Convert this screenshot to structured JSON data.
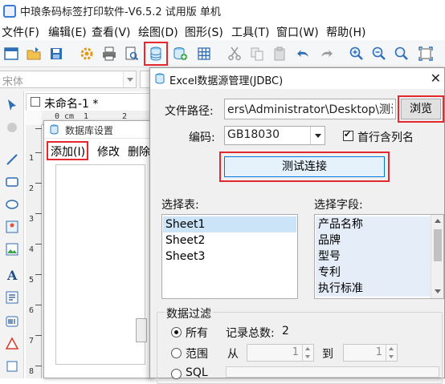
{
  "window": {
    "title": "中琅条码标签打印软件-V6.5.2 试用版 单机"
  },
  "menubar": {
    "items": [
      "文件(F)",
      "编辑(E)",
      "查看(V)",
      "绘图(D)",
      "图形(S)",
      "工具(T)",
      "窗口(W)",
      "帮助(H)"
    ]
  },
  "toolbar": {
    "icons": [
      "new-document-icon",
      "open-folder-icon",
      "save-icon",
      "settings-gear-icon",
      "print-icon",
      "print-preview-icon",
      "database-icon",
      "database-add-icon",
      "grid-icon",
      "cut-icon",
      "copy-icon",
      "paste-icon",
      "undo-icon",
      "redo-icon",
      "zoom-in-icon",
      "zoom-out-icon",
      "zoom-fit-icon",
      "zoom-page-icon"
    ],
    "highlighted": "database-icon"
  },
  "font_combo": {
    "value": "宋体"
  },
  "document": {
    "tab_label": "未命名-1 *",
    "ruler_top": [
      "0",
      "cm",
      "1",
      "2"
    ],
    "ruler_left": [
      "1",
      "2",
      "3",
      "4",
      "5",
      "6",
      "7",
      "8"
    ]
  },
  "db_settings": {
    "title": "数据库设置",
    "menu": {
      "add": "添加(I)",
      "modify": "修改",
      "delete": "删除"
    }
  },
  "excel_dialog": {
    "title": "Excel数据源管理(JDBC)",
    "close": "✕",
    "file_path_label": "文件路径:",
    "file_path_value": "ers\\Administrator\\Desktop\\测试.xls",
    "browse_label": "浏览",
    "encoding_label": "编码:",
    "encoding_value": "GB18030",
    "header_checkbox_label": "首行含列名",
    "header_checked": true,
    "test_button_label": "测试连接",
    "tables_label": "选择表:",
    "tables": [
      "Sheet1",
      "Sheet2",
      "Sheet3"
    ],
    "selected_table": "Sheet1",
    "fields_label": "选择字段:",
    "fields": [
      "产品名称",
      "品牌",
      "型号",
      "专利",
      "执行标准"
    ],
    "filter": {
      "group_label": "数据过滤",
      "all_label": "所有",
      "total_label": "记录总数:",
      "total_value": "2",
      "range_label": "范围",
      "from_label": "从",
      "from_value": "1",
      "to_label": "到",
      "to_value": "1",
      "sql_label": "SQL"
    }
  },
  "colors": {
    "highlight_red": "#e4282d",
    "selection_blue": "#cce4f7",
    "accent_blue": "#0078d7"
  }
}
